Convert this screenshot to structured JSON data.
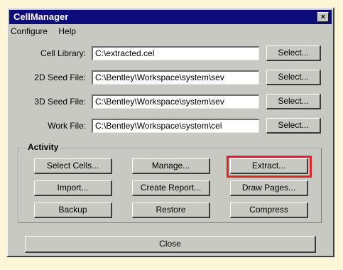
{
  "window": {
    "title": "CellManager",
    "close_glyph": "×"
  },
  "menu": {
    "items": [
      "Configure",
      "Help"
    ]
  },
  "fields": [
    {
      "label": "Cell Library:",
      "value": "C:\\extracted.cel",
      "button": "Select..."
    },
    {
      "label": "2D Seed File:",
      "value": "C:\\Bentley\\Workspace\\system\\sev",
      "button": "Select..."
    },
    {
      "label": "3D Seed File:",
      "value": "C:\\Bentley\\Workspace\\system\\sev",
      "button": "Select..."
    },
    {
      "label": "Work File:",
      "value": "C:\\Bentley\\Workspace\\system\\cel",
      "button": "Select..."
    }
  ],
  "activity": {
    "title": "Activity",
    "buttons": [
      "Select Cells...",
      "Manage...",
      "Extract...",
      "Import...",
      "Create Report...",
      "Draw Pages...",
      "Backup",
      "Restore",
      "Compress"
    ]
  },
  "footer": {
    "close_label": "Close"
  },
  "colors": {
    "titlebar": "#0c0c7a",
    "face": "#c9c9c4",
    "highlight": "#e0202a",
    "background": "#fdf6d6"
  }
}
